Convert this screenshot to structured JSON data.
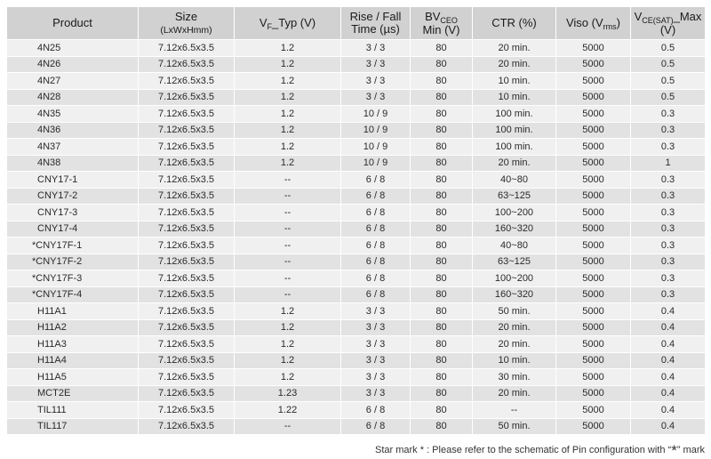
{
  "table": {
    "headers": {
      "product": "Product",
      "size_main": "Size",
      "size_sub": "(LxWxHmm)",
      "vf_main": "V",
      "vf_sub": "F",
      "vf_tail": "_Typ (V)",
      "rise_line1": "Rise / Fall",
      "rise_line2": "Time (µs)",
      "bv_main": "BV",
      "bv_sub": "CEO",
      "bv_line2": "Min (V)",
      "ctr": "CTR (%)",
      "viso_main": "Viso (V",
      "viso_sub": "rms",
      "viso_tail": ")",
      "vce_main": "V",
      "vce_sub": "CE(SAT)",
      "vce_tail": "_Max",
      "vce_line2": "(V)"
    },
    "rows": [
      [
        "4N25",
        "7.12x6.5x3.5",
        "1.2",
        "3 / 3",
        "80",
        "20 min.",
        "5000",
        "0.5"
      ],
      [
        "4N26",
        "7.12x6.5x3.5",
        "1.2",
        "3 / 3",
        "80",
        "20 min.",
        "5000",
        "0.5"
      ],
      [
        "4N27",
        "7.12x6.5x3.5",
        "1.2",
        "3 / 3",
        "80",
        "10 min.",
        "5000",
        "0.5"
      ],
      [
        "4N28",
        "7.12x6.5x3.5",
        "1.2",
        "3 / 3",
        "80",
        "10 min.",
        "5000",
        "0.5"
      ],
      [
        "4N35",
        "7.12x6.5x3.5",
        "1.2",
        "10 / 9",
        "80",
        "100 min.",
        "5000",
        "0.3"
      ],
      [
        "4N36",
        "7.12x6.5x3.5",
        "1.2",
        "10 / 9",
        "80",
        "100 min.",
        "5000",
        "0.3"
      ],
      [
        "4N37",
        "7.12x6.5x3.5",
        "1.2",
        "10 / 9",
        "80",
        "100 min.",
        "5000",
        "0.3"
      ],
      [
        "4N38",
        "7.12x6.5x3.5",
        "1.2",
        "10 / 9",
        "80",
        "20 min.",
        "5000",
        "1"
      ],
      [
        "CNY17-1",
        "7.12x6.5x3.5",
        "--",
        "6 / 8",
        "80",
        "40~80",
        "5000",
        "0.3"
      ],
      [
        "CNY17-2",
        "7.12x6.5x3.5",
        "--",
        "6 / 8",
        "80",
        "63~125",
        "5000",
        "0.3"
      ],
      [
        "CNY17-3",
        "7.12x6.5x3.5",
        "--",
        "6 / 8",
        "80",
        "100~200",
        "5000",
        "0.3"
      ],
      [
        "CNY17-4",
        "7.12x6.5x3.5",
        "--",
        "6 / 8",
        "80",
        "160~320",
        "5000",
        "0.3"
      ],
      [
        "*CNY17F-1",
        "7.12x6.5x3.5",
        "--",
        "6 / 8",
        "80",
        "40~80",
        "5000",
        "0.3"
      ],
      [
        "*CNY17F-2",
        "7.12x6.5x3.5",
        "--",
        "6 / 8",
        "80",
        "63~125",
        "5000",
        "0.3"
      ],
      [
        "*CNY17F-3",
        "7.12x6.5x3.5",
        "--",
        "6 / 8",
        "80",
        "100~200",
        "5000",
        "0.3"
      ],
      [
        "*CNY17F-4",
        "7.12x6.5x3.5",
        "--",
        "6 / 8",
        "80",
        "160~320",
        "5000",
        "0.3"
      ],
      [
        "H11A1",
        "7.12x6.5x3.5",
        "1.2",
        "3 / 3",
        "80",
        "50 min.",
        "5000",
        "0.4"
      ],
      [
        "H11A2",
        "7.12x6.5x3.5",
        "1.2",
        "3 / 3",
        "80",
        "20 min.",
        "5000",
        "0.4"
      ],
      [
        "H11A3",
        "7.12x6.5x3.5",
        "1.2",
        "3 / 3",
        "80",
        "20 min.",
        "5000",
        "0.4"
      ],
      [
        "H11A4",
        "7.12x6.5x3.5",
        "1.2",
        "3 / 3",
        "80",
        "10 min.",
        "5000",
        "0.4"
      ],
      [
        "H11A5",
        "7.12x6.5x3.5",
        "1.2",
        "3 / 3",
        "80",
        "30 min.",
        "5000",
        "0.4"
      ],
      [
        "MCT2E",
        "7.12x6.5x3.5",
        "1.23",
        "3 / 3",
        "80",
        "20 min.",
        "5000",
        "0.4"
      ],
      [
        "TIL111",
        "7.12x6.5x3.5",
        "1.22",
        "6 / 8",
        "80",
        "--",
        "5000",
        "0.4"
      ],
      [
        "TIL117",
        "7.12x6.5x3.5",
        "--",
        "6 / 8",
        "80",
        "50 min.",
        "5000",
        "0.4"
      ]
    ]
  },
  "footer": {
    "text_before": "Star mark * : Please refer to the schematic of Pin configuration with “",
    "star": "*",
    "text_after": "” mark"
  }
}
